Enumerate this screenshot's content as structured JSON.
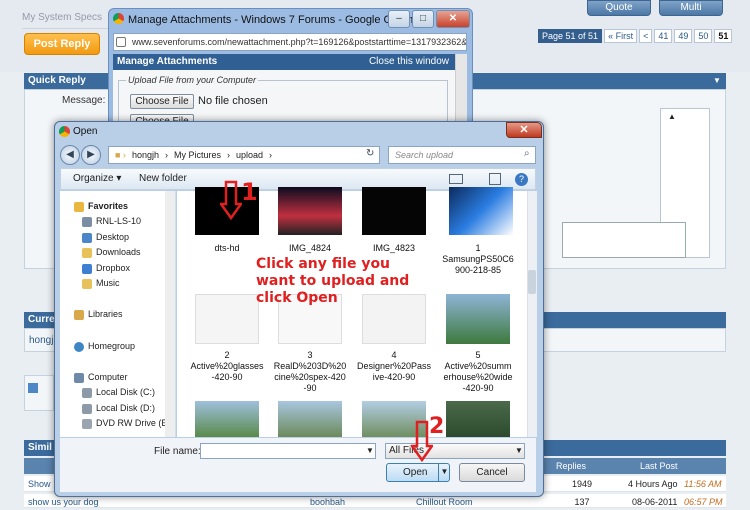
{
  "forum": {
    "my_specs": "My System Specs",
    "post_reply": "Post Reply",
    "quote": "Quote",
    "multi": "Multi",
    "pager": [
      "Page 51 of 51",
      "« First",
      "<",
      "41",
      "49",
      "50",
      "51"
    ],
    "quick_reply": "Quick Reply",
    "message_label": "Message:",
    "currently_heading": "Curre",
    "currently_user": "hongj",
    "similar_heading": "Simil",
    "col_replies": "Replies",
    "col_last_post": "Last Post",
    "rows": [
      {
        "thread": "Show",
        "forum": "",
        "replies": "1949",
        "date": "4 Hours Ago",
        "time": "11:56 AM"
      },
      {
        "thread": "show us your dog",
        "forum": "boohbah",
        "forum2": "Chillout Room",
        "replies": "137",
        "date": "08-06-2011",
        "time": "06:57 PM"
      }
    ]
  },
  "chrome": {
    "title": "Manage Attachments - Windows 7 Forums - Google Chrome",
    "url": "www.sevenforums.com/newattachment.php?t=169126&poststarttime=1317932362&",
    "header": "Manage Attachments",
    "close_window": "Close this window",
    "legend": "Upload File from your Computer",
    "choose_file": "Choose File",
    "no_file": "No file chosen",
    "choose_file2": "Choose File"
  },
  "dialog": {
    "title": "Open",
    "breadcrumb": [
      "hongjh",
      "My Pictures",
      "upload"
    ],
    "search_placeholder": "Search upload",
    "organize": "Organize ▾",
    "new_folder": "New folder",
    "nav": [
      {
        "label": "Favorites",
        "color": "#e9b640"
      },
      {
        "label": "RNL-LS-10",
        "color": "#7b8ea4"
      },
      {
        "label": "Desktop",
        "color": "#4a86c8"
      },
      {
        "label": "Downloads",
        "color": "#e7c15a"
      },
      {
        "label": "Dropbox",
        "color": "#3f7fd1"
      },
      {
        "label": "Music",
        "color": "#e7c15a"
      },
      {
        "label": "Libraries",
        "color": "#d9a84a"
      },
      {
        "label": "Homegroup",
        "color": "#3f86c5"
      },
      {
        "label": "Computer",
        "color": "#6e8aa8"
      },
      {
        "label": "Local Disk (C:)",
        "color": "#8d9aa8"
      },
      {
        "label": "Local Disk (D:)",
        "color": "#8d9aa8"
      },
      {
        "label": "DVD RW Drive (E:",
        "color": "#9aa5b1"
      }
    ],
    "files_row1": [
      "dts-hd",
      "IMG_4824",
      "IMG_4823",
      "1\nSamsungPS50C6\n900-218-85"
    ],
    "files_row2": [
      "2\nActive%20glasses\n-420-90",
      "3\nRealD%203D%20\ncine%20spex-420\n-90",
      "4\nDesigner%20Pass\nive-420-90",
      "5\nActive%20summ\nerhouse%20wide\n-420-90"
    ],
    "file_name_label": "File name:",
    "file_type": "All Files",
    "open": "Open",
    "cancel": "Cancel"
  },
  "annotation": {
    "step1": "1",
    "step2": "2",
    "instruction": "Click any file you want to upload and click Open",
    "color": "#e02020"
  }
}
